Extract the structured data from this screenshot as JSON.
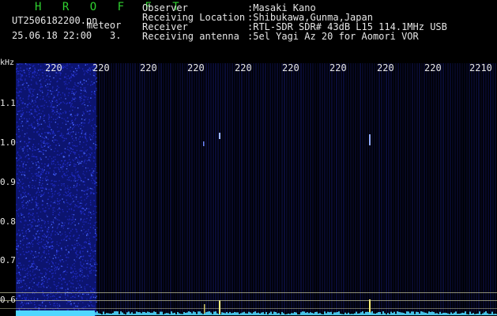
{
  "header": {
    "title": "H R O F F T",
    "filename": "UT2506182200.pn",
    "tag": "meteor",
    "datetime": "25.06.18 22:00",
    "count": "3."
  },
  "metadata": [
    {
      "label": "Observer",
      "value": ":Masaki Kano"
    },
    {
      "label": "Receiving Location",
      "value": ":Shibukawa,Gunma,Japan"
    },
    {
      "label": "Receiver",
      "value": ":RTL-SDR SDR# 43dB L15 114.1MHz USB"
    },
    {
      "label": "Receiving antenna",
      "value": ":5el Yagi Az 20 for Aomori VOR"
    }
  ],
  "axes": {
    "y_unit": "kHz",
    "x_ticks": [
      "220",
      "220",
      "220",
      "220",
      "220",
      "220",
      "220",
      "220",
      "220",
      "2210"
    ],
    "y_ticks": [
      "1.1",
      "1.0",
      "0.9",
      "0.8",
      "0.7",
      "0.6"
    ]
  },
  "colors": {
    "background": "#000000",
    "noise": "#1c22b8",
    "signal": "#fff27a",
    "baseline": "#4fd7ff",
    "text": "#e6e6e6",
    "accent": "#2fd12f"
  }
}
